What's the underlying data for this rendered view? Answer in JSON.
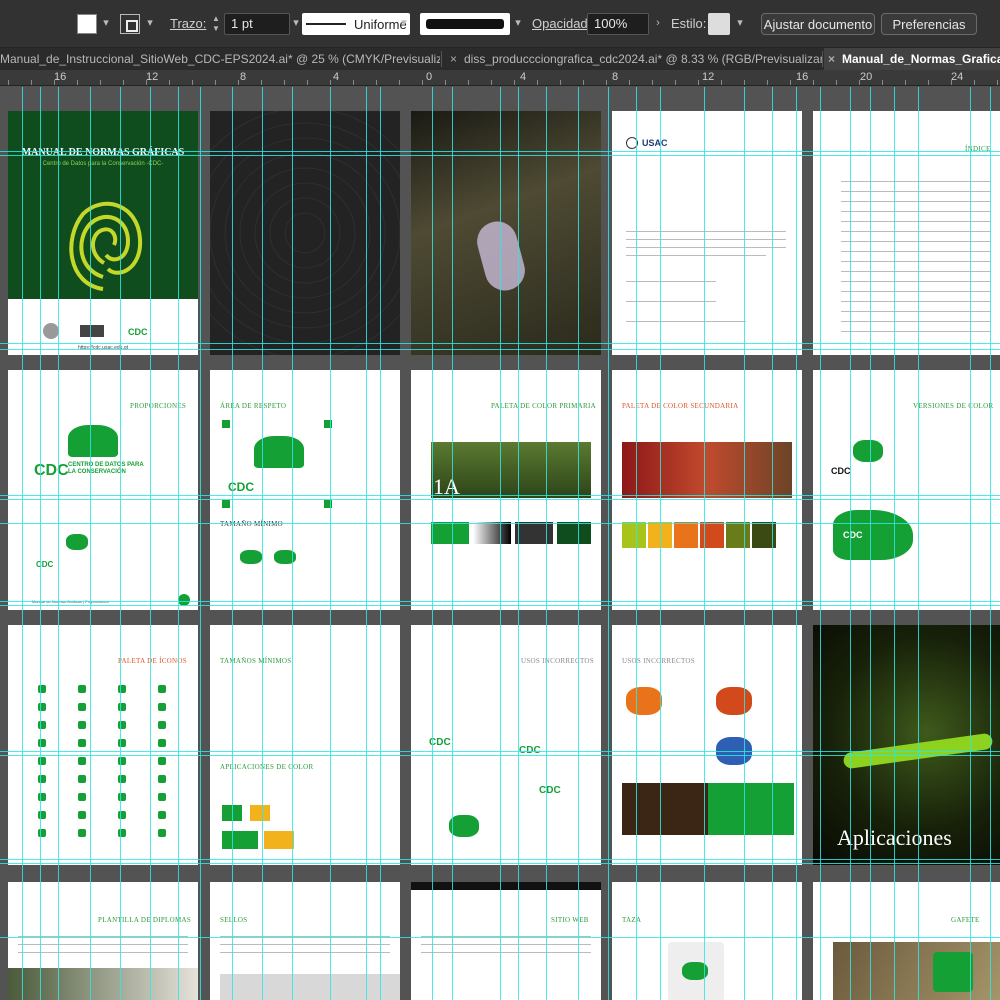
{
  "control_bar": {
    "stroke_label": "Trazo:",
    "stroke_weight": "1 pt",
    "stroke_profile": "Uniforme",
    "opacity_label": "Opacidad:",
    "opacity_value": "100%",
    "style_label": "Estilo:",
    "document_setup_button": "Ajustar documento",
    "preferences_button": "Preferencias"
  },
  "tabs": [
    {
      "label": "Manual_de_Instruccional_SitioWeb_CDC-EPS2024.ai* @ 25 % (CMYK/Previsualizar)"
    },
    {
      "label": "diss_produccciongrafica_cdc2024.ai* @ 8.33 % (RGB/Previsualizar)"
    },
    {
      "label": "Manual_de_Normas_Graficas_"
    }
  ],
  "ruler": [
    "16",
    "12",
    "8",
    "4",
    "0",
    "4",
    "8",
    "12",
    "16",
    "20",
    "24"
  ],
  "artboards": {
    "cover_title": "MANUAL DE NORMAS GRÁFICAS",
    "cover_subtitle": "Centro de Datos para la Conservación -CDC-",
    "cover_url": "https://cdc.usac.edu.gt",
    "indice": "ÍNDICE",
    "usac": "USAC",
    "proporciones": "PROPORCIONES",
    "area_respeto": "ÁREA DE RESPETO",
    "tamano_minimo": "TAMAÑO MÍNIMO",
    "paleta_primaria": "PALETA DE COLOR PRIMARIA",
    "paleta_secundaria": "PALETA DE COLOR SECUNDARIA",
    "versiones": "VERSIONES DE COLOR",
    "paleta_iconos": "PALETA DE ÍCONOS",
    "tamanos_minimos": "TAMAÑOS MÍNIMOS",
    "aplicaciones_color": "APLICACIONES DE COLOR",
    "usos_incorrectos": "USOS INCORRECTOS",
    "aplicaciones": "Aplicaciones",
    "plantilla_diplomas": "PLANTILLA DE DIPLOMAS",
    "sellos": "SELLOS",
    "sitio_web": "SITIO WEB",
    "taza": "TAZA",
    "gafete": "GAFETE",
    "cdc": "CDC",
    "cdc_name": "CENTRO DE DATOS PARA LA CONSERVACIÓN",
    "label_1a": "1A",
    "footer_manual": "Manual de Normas Gráficas",
    "footer_proporciones": "Proporciones"
  },
  "colors": {
    "guide": "#2ee6e6",
    "brand_green": "#15a036",
    "dark_green": "#0f4d1e",
    "orange": "#e0552a"
  }
}
